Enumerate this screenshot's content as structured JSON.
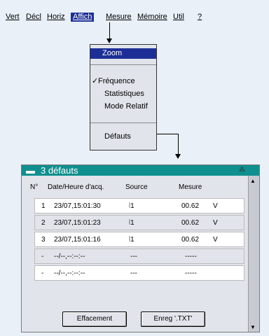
{
  "menubar": {
    "items": [
      {
        "label": "Vert"
      },
      {
        "label": "Décl"
      },
      {
        "label": "Horiz"
      },
      {
        "label": "Affich"
      },
      {
        "label": "Mesure"
      },
      {
        "label": "Mémoire"
      },
      {
        "label": "Util"
      },
      {
        "label": "?"
      }
    ]
  },
  "dropdown": {
    "zoom": "Zoom",
    "frequence": "Fréquence",
    "check": "✓",
    "statistiques": "Statistiques",
    "mode_relatif": "Mode Relatif",
    "defauts": "Défauts"
  },
  "window": {
    "title": "3 défauts",
    "title_icon": "minus-icon",
    "headers": {
      "no": "N°",
      "date": "Date/Heure d'acq.",
      "source": "Source",
      "mesure": "Mesure"
    },
    "rows": [
      {
        "no": "1",
        "date": "23/07,15:01:30",
        "source": "⦚1",
        "value": "00.62",
        "unit": "V"
      },
      {
        "no": "2",
        "date": "23/07,15:01:23",
        "source": "⦚1",
        "value": "00.62",
        "unit": "V"
      },
      {
        "no": "3",
        "date": "23/07,15:01:16",
        "source": "⦚1",
        "value": "00.62",
        "unit": "V"
      },
      {
        "no": "-",
        "date": "--/--,--:--:--",
        "source": "---",
        "value": "-----",
        "unit": ""
      },
      {
        "no": "-",
        "date": "--/--,--:--:--",
        "source": "---",
        "value": "-----",
        "unit": ""
      }
    ],
    "buttons": {
      "effacement": "Effacement",
      "enreg": "Enreg '.TXT'"
    }
  }
}
